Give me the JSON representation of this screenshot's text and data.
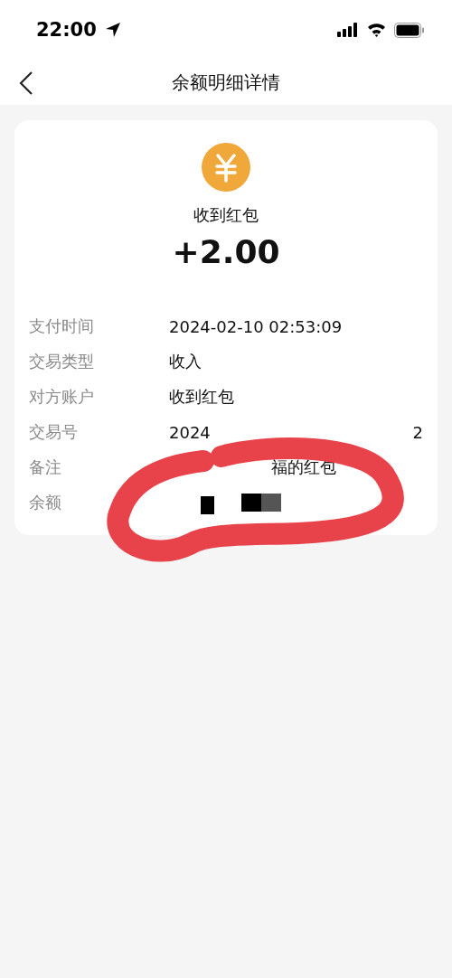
{
  "status_bar": {
    "time": "22:00"
  },
  "nav": {
    "title": "余额明细详情"
  },
  "summary": {
    "title": "收到红包",
    "amount": "+2.00"
  },
  "details": [
    {
      "kind": "text",
      "label": "支付时间",
      "value": "2024-02-10 02:53:09"
    },
    {
      "kind": "text",
      "label": "交易类型",
      "value": "收入"
    },
    {
      "kind": "text",
      "label": "对方账户",
      "value": "收到红包"
    },
    {
      "kind": "split",
      "label": "交易号",
      "value": "2024",
      "value_end": "2"
    },
    {
      "kind": "offset",
      "label": "备注",
      "value": "福的红包"
    },
    {
      "kind": "redacted",
      "label": "余额"
    }
  ]
}
